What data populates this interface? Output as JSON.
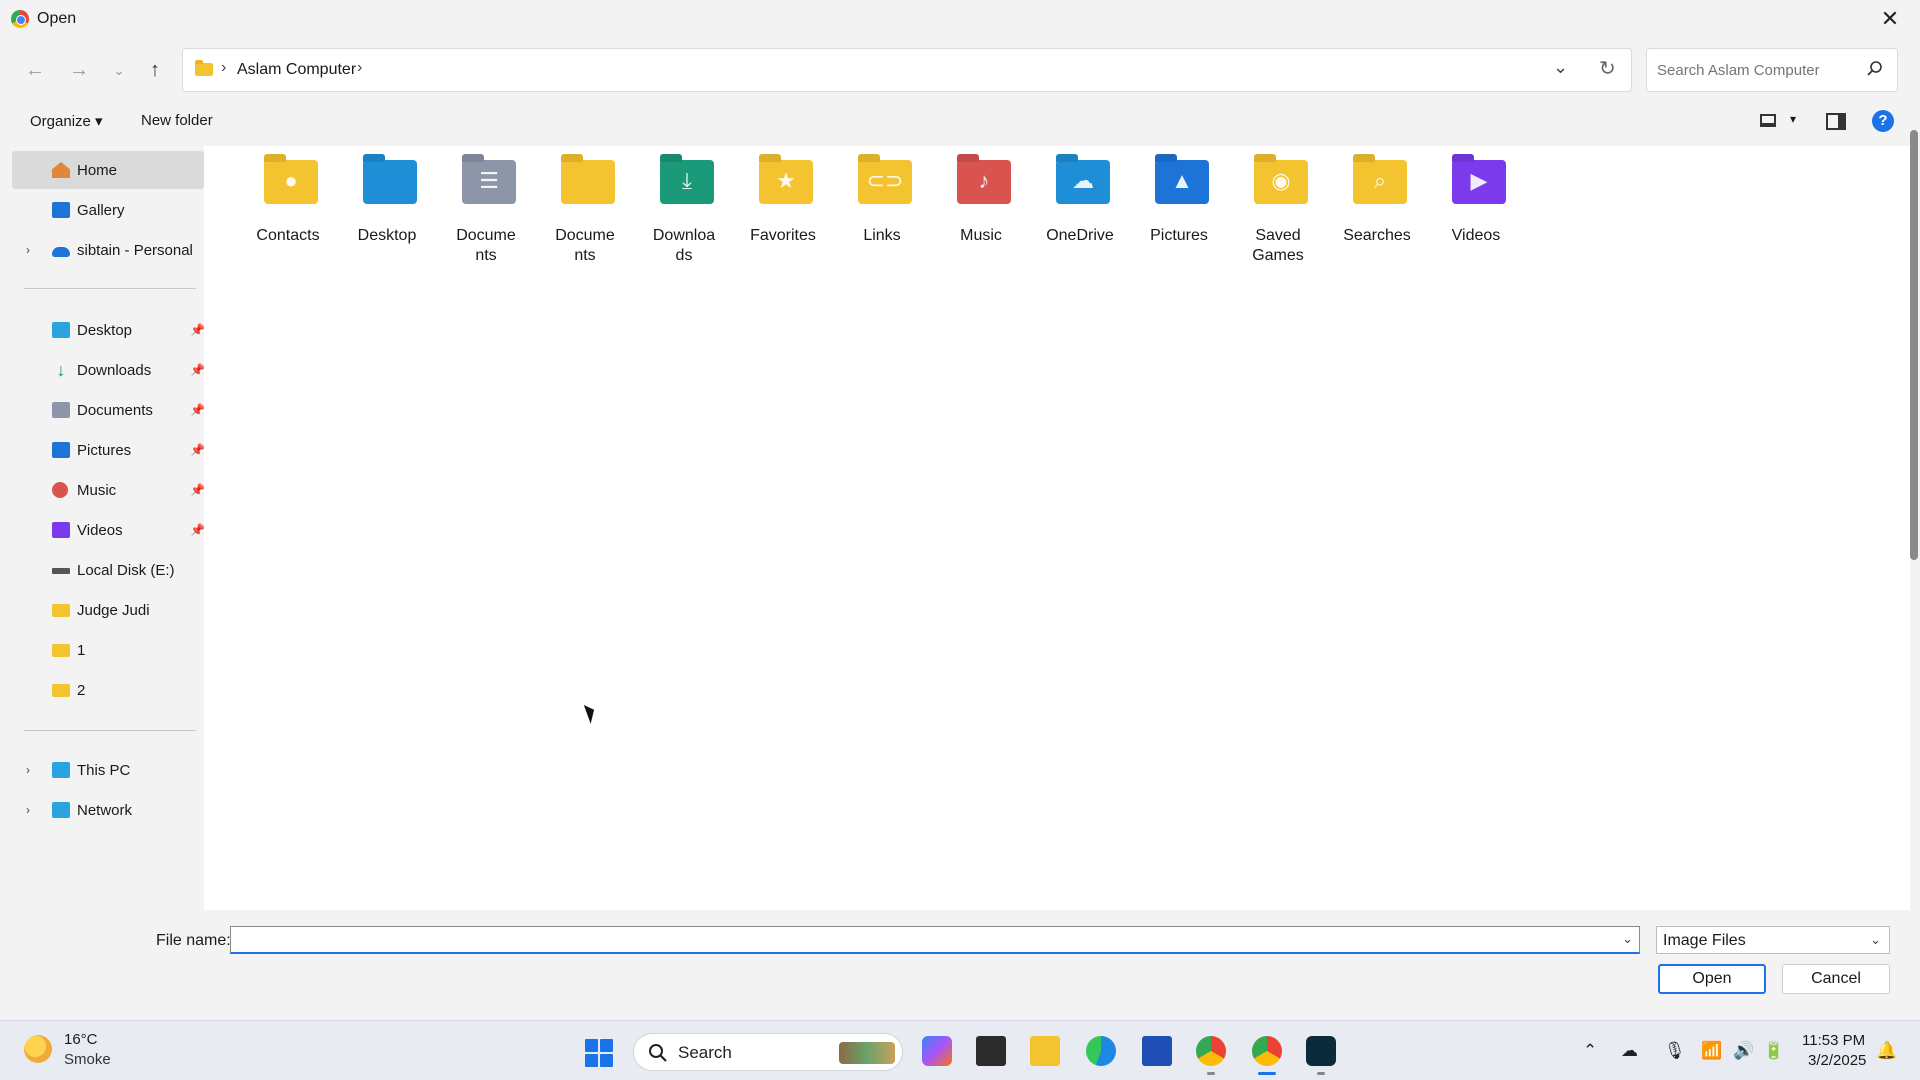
{
  "window": {
    "title": "Open",
    "close_label": "✕"
  },
  "address": {
    "crumbs": [
      "Aslam Computer"
    ],
    "search_placeholder": "Search Aslam Computer"
  },
  "toolbar": {
    "organize": "Organize ▾",
    "new_folder": "New folder"
  },
  "sidebar": {
    "top": [
      {
        "label": "Home",
        "icon": "home-icon",
        "selected": true
      },
      {
        "label": "Gallery",
        "icon": "gallery-icon"
      },
      {
        "label": "sibtain - Personal",
        "icon": "onedrive-icon",
        "expandable": true
      }
    ],
    "pinned": [
      {
        "label": "Desktop",
        "icon": "desktop-icon"
      },
      {
        "label": "Downloads",
        "icon": "download-icon"
      },
      {
        "label": "Documents",
        "icon": "documents-icon"
      },
      {
        "label": "Pictures",
        "icon": "pictures-icon"
      },
      {
        "label": "Music",
        "icon": "music-icon"
      },
      {
        "label": "Videos",
        "icon": "videos-icon"
      }
    ],
    "others": [
      {
        "label": "Local Disk (E:)",
        "icon": "disk-icon"
      },
      {
        "label": "Judge Judi",
        "icon": "folder-icon"
      },
      {
        "label": "1",
        "icon": "folder-icon"
      },
      {
        "label": "2",
        "icon": "folder-icon"
      }
    ],
    "bottom": [
      {
        "label": "This PC",
        "icon": "pc-icon"
      },
      {
        "label": "Network",
        "icon": "network-icon"
      }
    ]
  },
  "folders": [
    {
      "name": "Contacts",
      "color": "#f4c430",
      "glyph": "●"
    },
    {
      "name": "Desktop",
      "color": "#1e8fd6",
      "glyph": ""
    },
    {
      "name": "Documents",
      "display": "Docume\nnts",
      "color": "#8c96a8",
      "glyph": "☰"
    },
    {
      "name": "Documents",
      "display": "Docume\nnts",
      "color": "#f4c430",
      "glyph": ""
    },
    {
      "name": "Downloads",
      "display": "Downloa\nds",
      "color": "#1b9a7a",
      "glyph": "⤓"
    },
    {
      "name": "Favorites",
      "color": "#f4c430",
      "glyph": "★"
    },
    {
      "name": "Links",
      "color": "#f4c430",
      "glyph": "⊂⊃"
    },
    {
      "name": "Music",
      "color": "#d9534f",
      "glyph": "♪"
    },
    {
      "name": "OneDrive",
      "color": "#1e8fd6",
      "glyph": "☁"
    },
    {
      "name": "Pictures",
      "color": "#1e73d6",
      "glyph": "▲"
    },
    {
      "name": "Saved Games",
      "display": "Saved\nGames",
      "color": "#f4c430",
      "glyph": "◉"
    },
    {
      "name": "Searches",
      "color": "#f4c430",
      "glyph": "⌕"
    },
    {
      "name": "Videos",
      "color": "#7c3aed",
      "glyph": "▶"
    }
  ],
  "footer": {
    "file_name_label": "File name:",
    "file_name_value": "",
    "file_type": "Image Files",
    "open_label": "Open",
    "cancel_label": "Cancel"
  },
  "taskbar": {
    "weather_temp": "16°C",
    "weather_cond": "Smoke",
    "search_label": "Search",
    "time": "11:53 PM",
    "date": "3/2/2025"
  }
}
